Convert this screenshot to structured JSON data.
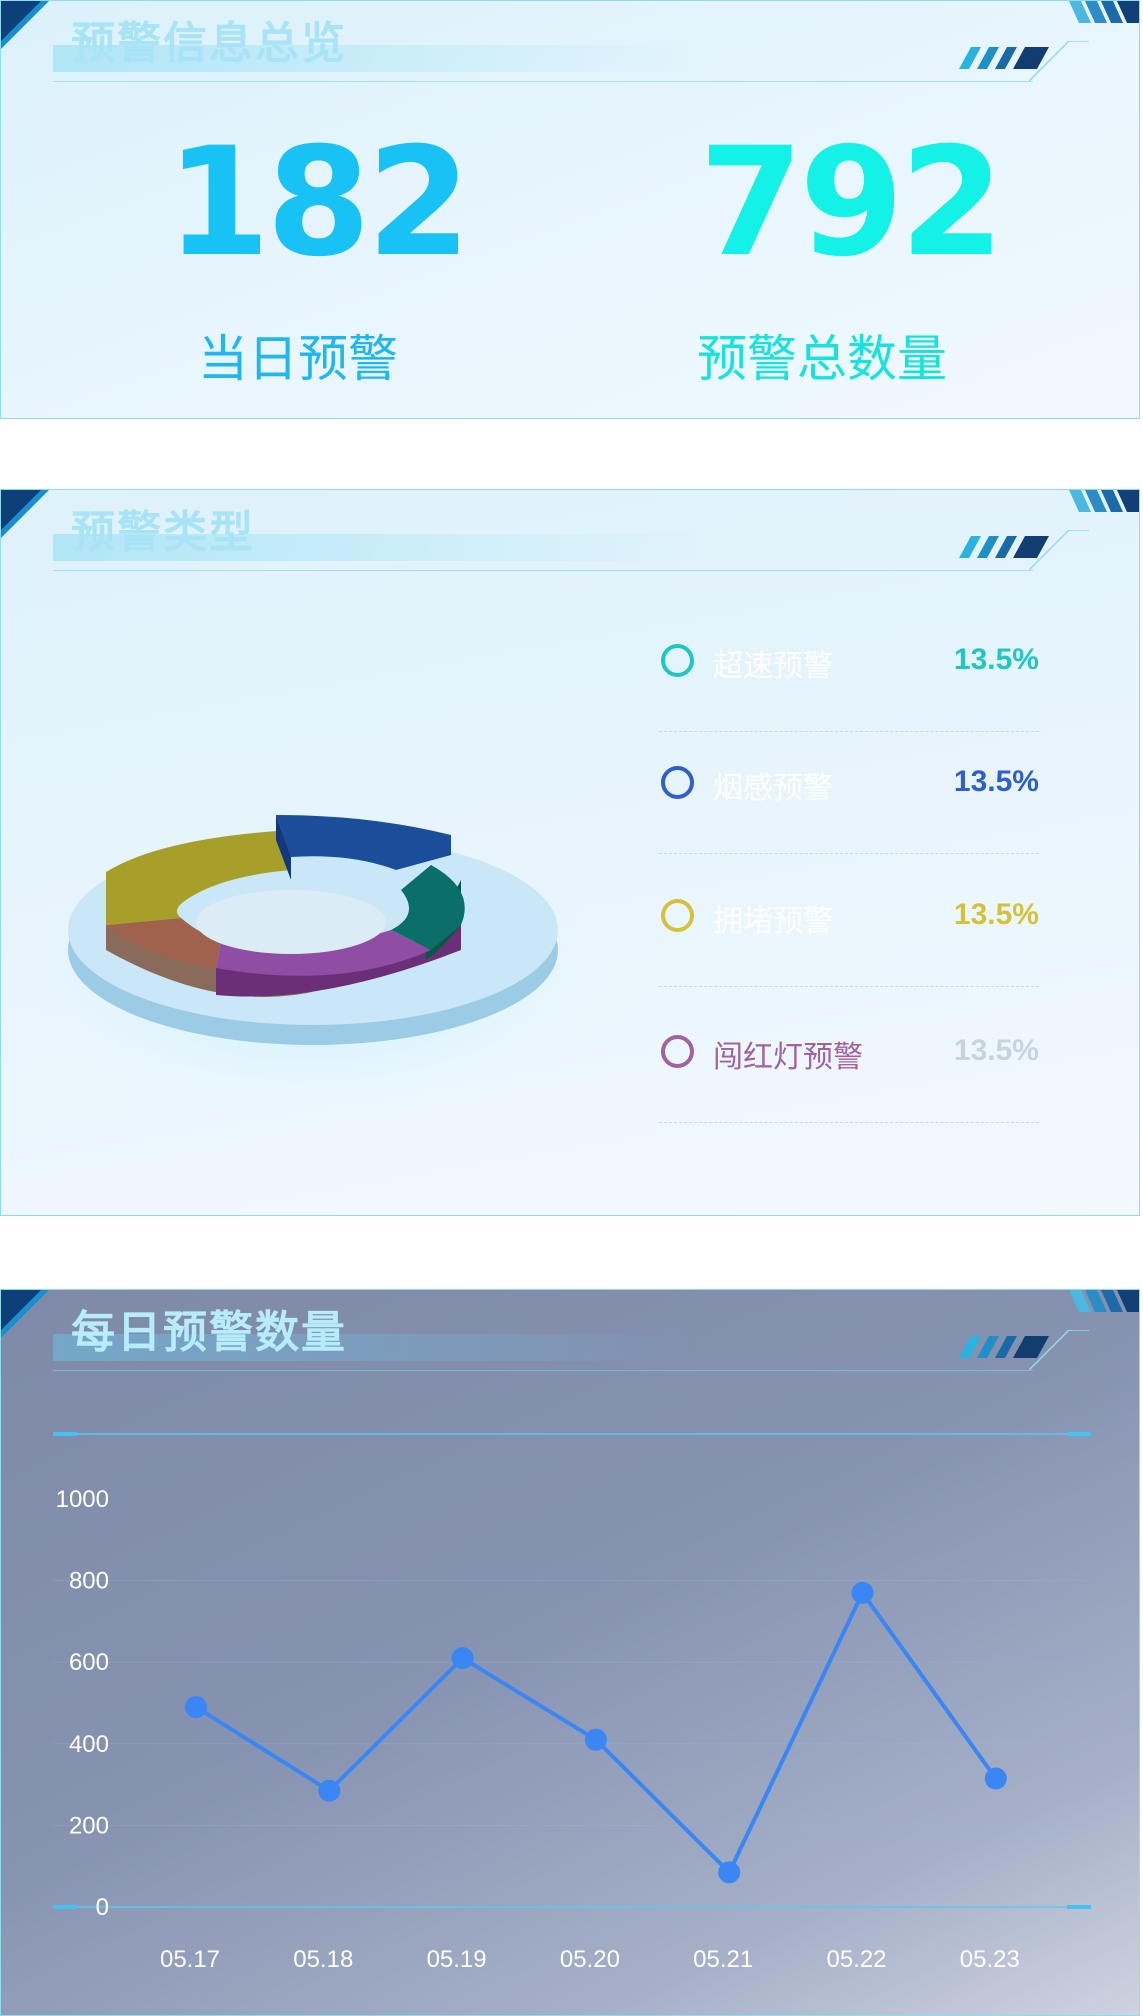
{
  "overview": {
    "title": "预警信息总览",
    "today_value": "182",
    "today_label": "当日预警",
    "total_value": "792",
    "total_label": "预警总数量"
  },
  "types": {
    "title": "预警类型",
    "items": [
      {
        "label": "超速预警",
        "percent": "13.5%",
        "color": "#1fc6c3"
      },
      {
        "label": "烟感预警",
        "percent": "13.5%",
        "color": "#2f5fc8"
      },
      {
        "label": "拥堵预警",
        "percent": "13.5%",
        "color": "#d2c33a"
      },
      {
        "label": "闯红灯预警",
        "percent": "13.5%",
        "color": "#a062a0"
      }
    ]
  },
  "daily": {
    "title": "每日预警数量",
    "chart_data": {
      "type": "line",
      "x": [
        "05.17",
        "05.18",
        "05.19",
        "05.20",
        "05.21",
        "05.22",
        "05.23"
      ],
      "y_ticks": [
        "1000",
        "800",
        "600",
        "400",
        "200",
        "0"
      ],
      "values": [
        490,
        285,
        610,
        410,
        85,
        770,
        315
      ],
      "ylim": [
        0,
        1000
      ],
      "color": "#3a86f5"
    }
  }
}
